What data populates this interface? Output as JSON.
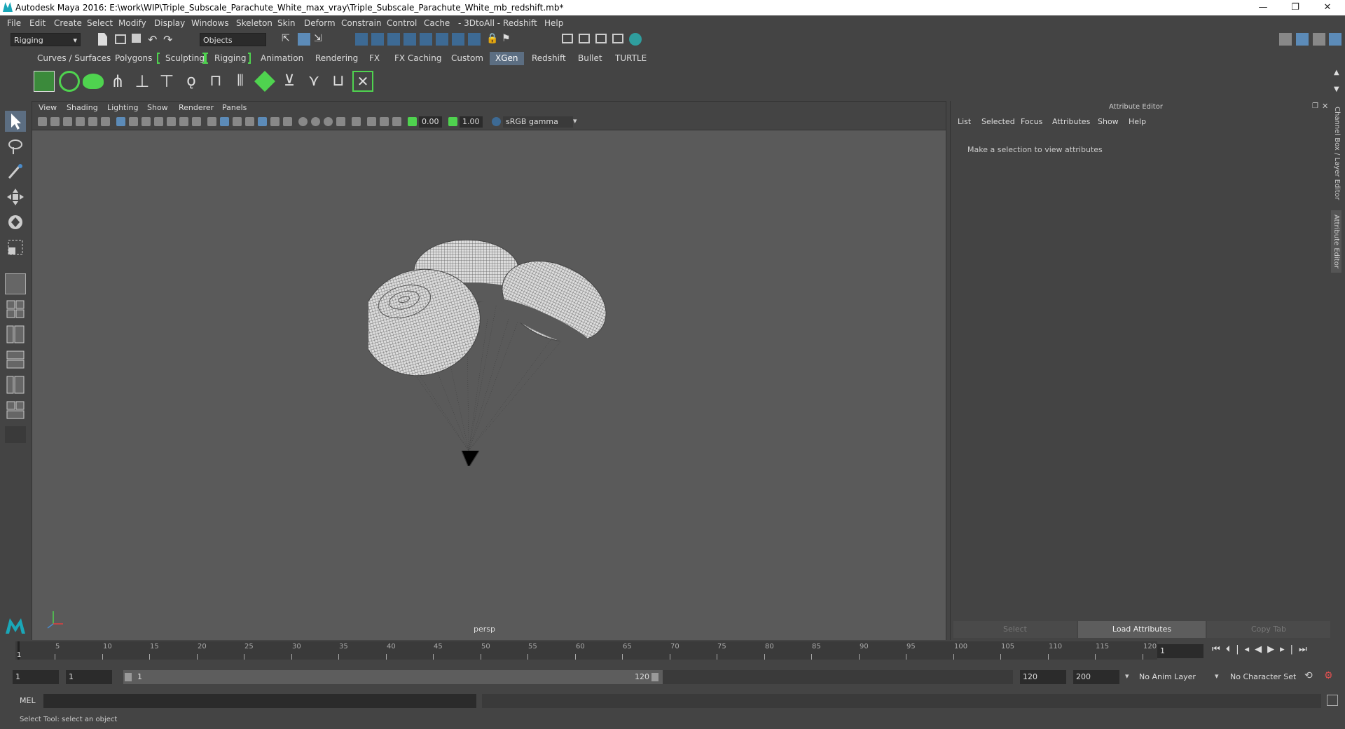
{
  "window": {
    "title": "Autodesk Maya 2016: E:\\work\\WIP\\Triple_Subscale_Parachute_White_max_vray\\Triple_Subscale_Parachute_White_mb_redshift.mb*",
    "minimize": "—",
    "maximize": "❐",
    "close": "✕"
  },
  "menubar": [
    "File",
    "Edit",
    "Create",
    "Select",
    "Modify",
    "Display",
    "Windows",
    "Skeleton",
    "Skin",
    "Deform",
    "Constrain",
    "Control",
    "Cache",
    "- 3DtoAll -",
    "Redshift",
    "Help"
  ],
  "status_line": {
    "menu_set": "Rigging",
    "selection_mode": "Objects"
  },
  "shelf_tabs": [
    "Curves / Surfaces",
    "Polygons",
    "Sculpting",
    "Rigging",
    "Animation",
    "Rendering",
    "FX",
    "FX Caching",
    "Custom",
    "XGen",
    "Redshift",
    "Bullet",
    "TURTLE"
  ],
  "active_shelf_tab": "XGen",
  "viewport": {
    "menus": [
      "View",
      "Shading",
      "Lighting",
      "Show",
      "Renderer",
      "Panels"
    ],
    "exposure": "0.00",
    "gamma": "1.00",
    "color_space": "sRGB gamma",
    "camera_label": "persp"
  },
  "attribute_editor": {
    "title": "Attribute Editor",
    "menus": [
      "List",
      "Selected",
      "Focus",
      "Attributes",
      "Show",
      "Help"
    ],
    "message": "Make a selection to view attributes",
    "buttons": {
      "select": "Select",
      "load": "Load Attributes",
      "copy": "Copy Tab"
    },
    "side_tabs": {
      "channel_box": "Channel Box / Layer Editor",
      "attribute_editor": "Attribute Editor"
    }
  },
  "timeline": {
    "ticks": [
      "1",
      "5",
      "10",
      "15",
      "20",
      "25",
      "30",
      "35",
      "40",
      "45",
      "50",
      "55",
      "60",
      "65",
      "70",
      "75",
      "80",
      "85",
      "90",
      "95",
      "100",
      "105",
      "110",
      "115",
      "120"
    ],
    "current_frame": "1"
  },
  "range": {
    "start": "1",
    "playback_start": "1",
    "slider_start": "1",
    "slider_end": "120",
    "playback_end": "120",
    "end": "200",
    "anim_layer": "No Anim Layer",
    "character_set": "No Character Set"
  },
  "command_line": {
    "language": "MEL"
  },
  "help_line": "Select Tool: select an object",
  "colors": {
    "accent": "#5c6e82",
    "bracket_green": "#4fd34f",
    "viewport_bg": "#5a5a5a"
  }
}
